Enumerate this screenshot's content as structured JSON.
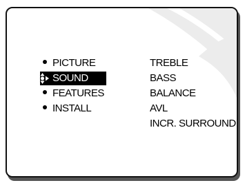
{
  "main_menu": {
    "items": [
      {
        "label": "PICTURE",
        "selected": false,
        "marker": "bullet"
      },
      {
        "label": "SOUND",
        "selected": true,
        "marker": "up-down-right-arrow-icon"
      },
      {
        "label": "FEATURES",
        "selected": false,
        "marker": "bullet"
      },
      {
        "label": "INSTALL",
        "selected": false,
        "marker": "bullet"
      }
    ]
  },
  "sound_submenu": {
    "items": [
      "TREBLE",
      "BASS",
      "BALANCE",
      "AVL",
      "INCR. SURROUND"
    ]
  },
  "colors": {
    "highlight_background": "#000000",
    "highlight_text": "#ffffff",
    "text": "#000000",
    "frame": "#111111",
    "watermark": "#ececec"
  }
}
